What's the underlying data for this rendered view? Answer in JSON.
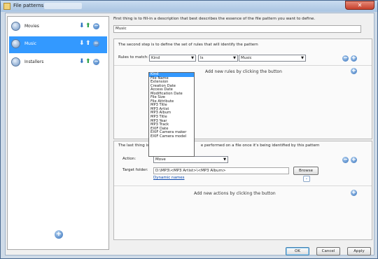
{
  "window": {
    "title": "File patterns",
    "close_glyph": "✕"
  },
  "sidebar": {
    "items": [
      {
        "label": "Movies",
        "icon": "movies-icon"
      },
      {
        "label": "Music",
        "icon": "music-icon",
        "selected": true
      },
      {
        "label": "Installers",
        "icon": "installers-icon"
      }
    ],
    "down_glyph": "⬇",
    "up_glyph": "⬆",
    "remove_glyph": "−",
    "add_glyph": "+"
  },
  "description": {
    "prompt": "First thing is to fill-in a description that best describes the essence of the file pattern you want to define.",
    "value": "Music"
  },
  "rules": {
    "prompt": "The second step is to define the set of rules that will identify the pattern",
    "label": "Rules to match:",
    "field_value": "Kind",
    "operator_value": "Is",
    "match_value": "Music",
    "add_hint": "Add new rules by clicking the button",
    "dropdown_glyph": "▼",
    "options": [
      "Kind",
      "File Name",
      "Extension",
      "Creation Date",
      "Access Date",
      "Modification Date",
      "File Size",
      "File Attribute",
      "MP3 Title",
      "MP3 Artist",
      "MP3 Album",
      "MP3 Title",
      "MP3 Year",
      "MP3 Track",
      "EXIF Date",
      "EXIF Camera maker",
      "EXIF Camera model"
    ]
  },
  "actions": {
    "prompt_start": "The last thing is t",
    "prompt_end": "e performed on a file once it's being identified by this pattern",
    "action_label": "Action:",
    "action_value": "Move",
    "target_label": "Target folder:",
    "target_value": "D:\\MP3\\<MP3 Artist>\\<MP3 Album>",
    "browse_label": "Browse",
    "dynamic_link": "Dynamic names",
    "chevron_glyph": "⌄",
    "add_hint": "Add new actions by clicking the button"
  },
  "buttons": {
    "ok": "OK",
    "cancel": "Cancel",
    "apply": "Apply"
  },
  "colors": {
    "selection": "#3399ff",
    "accent_blue": "#2d6bb8",
    "link": "#0645ad"
  }
}
